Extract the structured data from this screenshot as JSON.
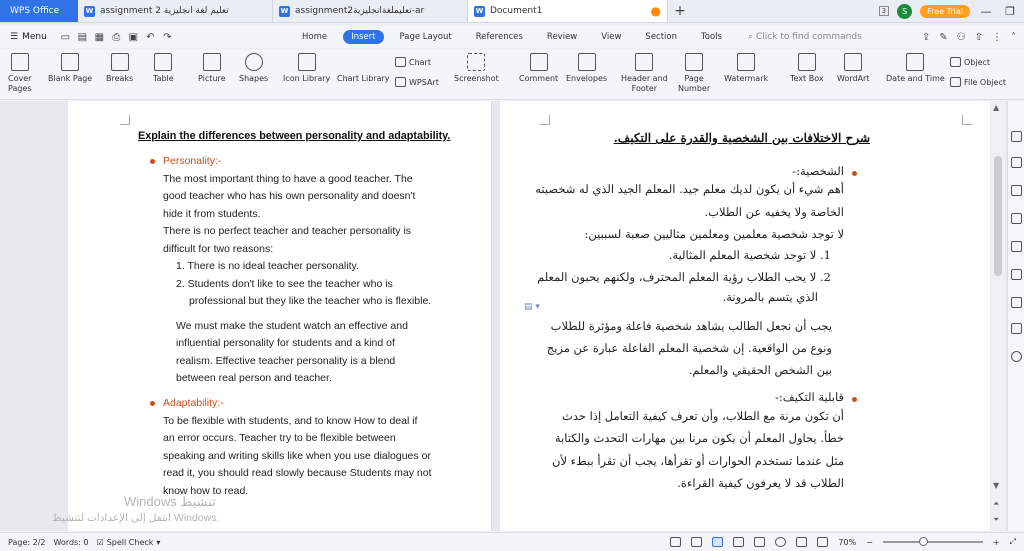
{
  "tabs": {
    "app": "WPS Office",
    "docs": [
      {
        "title": "assignment 2 تعليم لغة انجليزية"
      },
      {
        "title": "assignment2تعليملغةانجليزية-ar"
      },
      {
        "title": "Document1"
      }
    ],
    "window_count": "3",
    "user_initial": "S",
    "trial": "Free Trial"
  },
  "menu": {
    "label": "Menu",
    "tabs": [
      "Home",
      "Insert",
      "Page Layout",
      "References",
      "Review",
      "View",
      "Section",
      "Tools"
    ],
    "find_placeholder": "Click to find commands"
  },
  "ribbon": {
    "cover_pages_1": "Cover",
    "cover_pages_2": "Pages",
    "blank_page": "Blank Page",
    "breaks": "Breaks",
    "table": "Table",
    "picture": "Picture",
    "shapes": "Shapes",
    "icon_library": "Icon Library",
    "chart": "Chart",
    "chart_library": "Chart Library",
    "wpsart": "WPSArt",
    "screenshot": "Screenshot",
    "comment": "Comment",
    "envelopes": "Envelopes",
    "header_footer_1": "Header and",
    "header_footer_2": "Footer",
    "page_number_1": "Page",
    "page_number_2": "Number",
    "watermark": "Watermark",
    "text_box": "Text Box",
    "wordart": "WordArt",
    "date_time": "Date and Time",
    "object": "Object",
    "file_object": "File Object"
  },
  "doc_left": {
    "heading": "Explain the differences between personality and adaptability.",
    "personality_title": "Personality:-",
    "p1": [
      "The most important thing to have a good teacher. The",
      "good teacher who has his own personality and doesn't",
      "hide it from students.",
      "There is no perfect teacher and teacher personality is",
      "difficult for two reasons:"
    ],
    "list": [
      "1. There is no ideal teacher personality.",
      "2. Students don't like to see the teacher who is",
      "professional but they like the teacher who is flexible."
    ],
    "p2": [
      "We must make the student watch an effective and",
      "influential personality for students and a kind of",
      "realism. Effective teacher personality is a blend",
      "between real person and teacher."
    ],
    "adapt_title": "Adaptability:-",
    "p3": [
      "To be flexible with students, and to know How to deal if",
      "an error occurs. Teacher try to be flexible between",
      "speaking and writing skills like when you use dialogues or",
      "read it, you should read slowly because Students may not",
      "know how to read."
    ]
  },
  "doc_right": {
    "heading": "شرح الاختلافات بين الشخصية والقدرة على التكيف.",
    "personality_title": "الشخصية:-",
    "p1": [
      "أهم شيء أن يكون لديك معلم جيد. المعلم الجيد الذي له شخصيته",
      "الخاصة ولا يخفيه عن الطلاب.",
      "لا توجد شخصية معلمين ومعلمين مثاليين صعبة لسببين:"
    ],
    "list": [
      "1. لا توجد شخصية المعلم المثالية.",
      "2. لا يحب الطلاب رؤية المعلم المحترف، ولكنهم يحبون المعلم",
      "الذي يتسم بالمرونة."
    ],
    "p2": [
      "يجب أن نجعل الطالب يشاهد شخصية فاعلة ومؤثرة للطلاب",
      "ونوع من الواقعية. إن شخصية المعلم الفاعلة عبارة عن مزيج",
      "بين الشخص الحقيقي والمعلم."
    ],
    "adapt_title": "قابلية التكيف:-",
    "p3": [
      "أن تكون مرنة مع الطلاب، وأن تعرف كيفية التعامل إذا حدث",
      "خطأ. يحاول المعلم أن يكون مرنا بين مهارات التحدث والكتابة",
      "مثل عندما تستخدم الحوارات أو تقرأها، يجب أن تقرأ ببطء لأن",
      "الطلاب قد لا يعرفون كيفية القراءة."
    ]
  },
  "watermark": {
    "line1": "Windows تنشيط",
    "line2": "انتقل إلى الإعدادات لتنشيط Windows."
  },
  "status": {
    "page": "Page: 2/2",
    "words": "Words: 0",
    "spell": "Spell Check",
    "zoom": "70%",
    "zoom_fraction": 0.4
  }
}
